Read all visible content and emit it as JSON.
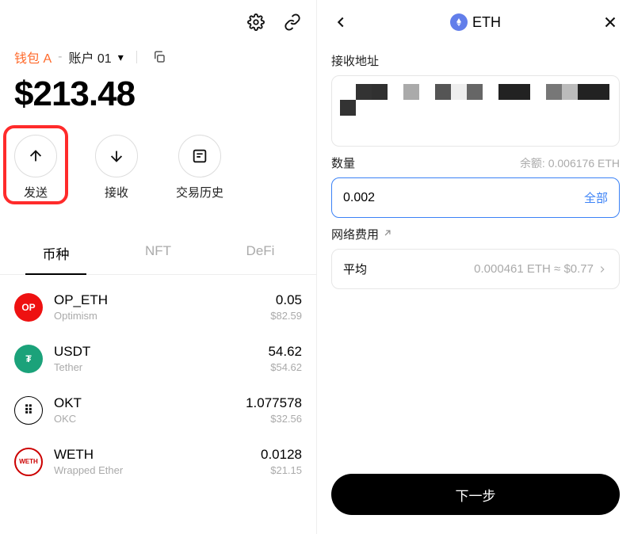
{
  "wallet_left": {
    "wallet_name": "钱包 A",
    "account_name": "账户 01",
    "balance_display": "$213.48",
    "actions": {
      "send": "发送",
      "receive": "接收",
      "history": "交易历史"
    },
    "tabs": {
      "tokens": "币种",
      "nft": "NFT",
      "defi": "DeFi"
    },
    "tokens": [
      {
        "symbol": "OP_ETH",
        "chain": "Optimism",
        "amount": "0.05",
        "fiat": "$82.59",
        "icon": "OP"
      },
      {
        "symbol": "USDT",
        "chain": "Tether",
        "amount": "54.62",
        "fiat": "$54.62",
        "icon": "₮"
      },
      {
        "symbol": "OKT",
        "chain": "OKC",
        "amount": "1.077578",
        "fiat": "$32.56",
        "icon": "⠿"
      },
      {
        "symbol": "WETH",
        "chain": "Wrapped Ether",
        "amount": "0.0128",
        "fiat": "$21.15",
        "icon": "WETH"
      }
    ]
  },
  "send_right": {
    "asset": "ETH",
    "section_addr": "接收地址",
    "section_amount": "数量",
    "balance_label": "余额: 0.006176 ETH",
    "amount_value": "0.002",
    "all_label": "全部",
    "section_fee": "网络费用",
    "fee_speed": "平均",
    "fee_value": "0.000461 ETH ≈ $0.77",
    "next_label": "下一步"
  }
}
